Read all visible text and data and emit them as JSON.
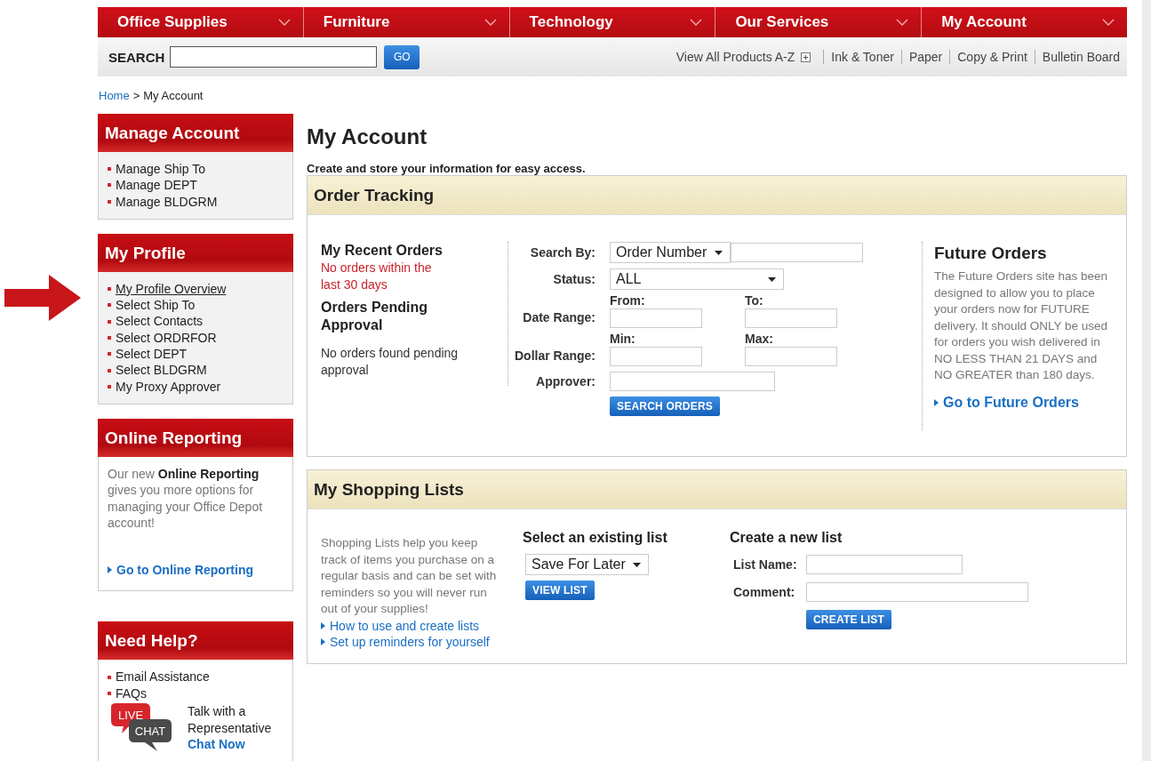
{
  "nav": {
    "tabs": [
      {
        "label": "Office Supplies"
      },
      {
        "label": "Furniture"
      },
      {
        "label": "Technology"
      },
      {
        "label": "Our Services"
      },
      {
        "label": "My Account"
      }
    ]
  },
  "search": {
    "label": "SEARCH",
    "button": "GO"
  },
  "quick_links": [
    {
      "label": "View All Products A-Z",
      "expand": true
    },
    {
      "label": "Ink & Toner",
      "expand": false
    },
    {
      "label": "Paper",
      "expand": false
    },
    {
      "label": "Copy & Print",
      "expand": false
    },
    {
      "label": "Bulletin Board",
      "expand": false
    }
  ],
  "breadcrumb": {
    "home": "Home",
    "separator": ">",
    "current": "My Account"
  },
  "sidebar": [
    {
      "kind": "links",
      "title": "Manage Account",
      "items": [
        {
          "label": "Manage Ship To",
          "selected": false
        },
        {
          "label": "Manage DEPT",
          "selected": false
        },
        {
          "label": "Manage BLDGRM",
          "selected": false
        }
      ]
    },
    {
      "kind": "links",
      "title": "My Profile",
      "items": [
        {
          "label": "My Profile Overview",
          "selected": true
        },
        {
          "label": "Select Ship To",
          "selected": false
        },
        {
          "label": "Select Contacts",
          "selected": false
        },
        {
          "label": "Select ORDRFOR",
          "selected": false
        },
        {
          "label": "Select DEPT",
          "selected": false
        },
        {
          "label": "Select BLDGRM",
          "selected": false
        },
        {
          "label": "My Proxy Approver",
          "selected": false
        }
      ]
    },
    {
      "kind": "promo",
      "title": "Online Reporting",
      "text": "Our new **Online Reporting** gives you more options for managing your Office Depot account!",
      "link": "Go to Online Reporting"
    },
    {
      "kind": "help",
      "title": "Need Help?",
      "items": [
        {
          "label": "Email Assistance",
          "selected": false
        },
        {
          "label": "FAQs",
          "selected": false
        }
      ],
      "chat": {
        "badge_top": "LIVE",
        "badge_bottom": "CHAT",
        "line_1": "Talk with a",
        "line_2": "Representative",
        "link": "Chat Now"
      }
    }
  ],
  "page": {
    "title": "My Account",
    "intro": "Create and store your information for easy access."
  },
  "order_tracking": {
    "title": "Order Tracking",
    "recent": {
      "title": "My Recent Orders",
      "message": "No orders within the last 30 days"
    },
    "pending": {
      "title": "Orders Pending Approval",
      "message": "No orders found pending approval"
    },
    "form": {
      "search_by": {
        "label": "Search By:",
        "value": "Order Number"
      },
      "status": {
        "label": "Status:",
        "value": "ALL"
      },
      "date_range": {
        "label": "Date Range:",
        "from_label": "From:",
        "to_label": "To:"
      },
      "dollar_range": {
        "label": "Dollar Range:",
        "from_label": "Min:",
        "to_label": "Max:"
      },
      "approver": {
        "label": "Approver:"
      },
      "button": "SEARCH ORDERS"
    },
    "future": {
      "title": "Future Orders",
      "text": "The Future Orders site has been designed to allow you to place your orders now for FUTURE delivery. It should ONLY be used for orders you wish delivered in NO LESS THAN 21 DAYS and NO GREATER than 180 days.",
      "link": "Go to Future Orders"
    }
  },
  "shopping_lists": {
    "title": "My Shopping Lists",
    "text": "Shopping Lists help you keep track of items you purchase on a regular basis and can be set with reminders so you will never run out of your supplies!",
    "links": [
      "How to use and create lists",
      "Set up reminders for yourself"
    ],
    "existing": {
      "title": "Select an existing list",
      "value": "Save For Later",
      "button": "VIEW LIST"
    },
    "create": {
      "title": "Create a new list",
      "fields": [
        {
          "label": "List Name:"
        },
        {
          "label": "Comment:"
        }
      ],
      "button": "CREATE LIST"
    }
  }
}
